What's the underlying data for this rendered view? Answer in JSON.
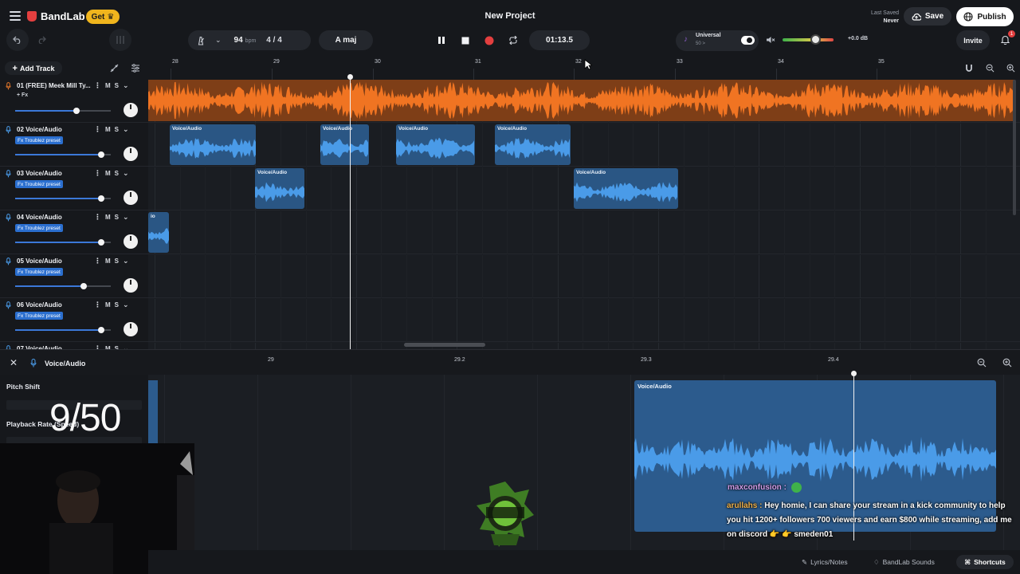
{
  "brand": {
    "name": "BandLab",
    "get_label": "Get"
  },
  "project": {
    "title": "New Project"
  },
  "save_status": {
    "label": "Last Saved",
    "value": "Never"
  },
  "header": {
    "save_label": "Save",
    "publish_label": "Publish",
    "invite_label": "Invite",
    "notification_count": "1"
  },
  "transport": {
    "bpm": "94",
    "bpm_unit": "bpm",
    "time_signature": "4 / 4",
    "key": "A maj",
    "time": "01:13.5"
  },
  "instrument": {
    "name": "Universal",
    "sub": "50 >"
  },
  "master": {
    "db": "+0.0 dB",
    "volume_level": 0.62
  },
  "tracks_panel": {
    "add_track_label": "Add Track"
  },
  "ruler": {
    "ticks": [
      "28",
      "29",
      "30",
      "31",
      "32",
      "33",
      "34",
      "35"
    ]
  },
  "tracks": [
    {
      "name": "01  (FREE) Meek Mill Ty...",
      "fx": "+ Fx",
      "fx_badge": false,
      "volume": 0.64,
      "mute": "M",
      "solo": "S"
    },
    {
      "name": "02  Voice/Audio",
      "fx": "Fx Troublez preset",
      "fx_badge": true,
      "volume": 0.9,
      "mute": "M",
      "solo": "S"
    },
    {
      "name": "03  Voice/Audio",
      "fx": "Fx Troublez preset",
      "fx_badge": true,
      "volume": 0.9,
      "mute": "M",
      "solo": "S"
    },
    {
      "name": "04  Voice/Audio",
      "fx": "Fx Troublez preset",
      "fx_badge": true,
      "volume": 0.9,
      "mute": "M",
      "solo": "S"
    },
    {
      "name": "05  Voice/Audio",
      "fx": "Fx Troublez preset",
      "fx_badge": true,
      "volume": 0.72,
      "mute": "M",
      "solo": "S"
    },
    {
      "name": "06  Voice/Audio",
      "fx": "Fx Troublez preset",
      "fx_badge": true,
      "volume": 0.9,
      "mute": "M",
      "solo": "S"
    },
    {
      "name": "07  Voice/Audio",
      "fx": "",
      "fx_badge": false,
      "volume": 0.9,
      "mute": "M",
      "solo": "S"
    }
  ],
  "clip_label": "Voice/Audio",
  "clip_label_cut": "io",
  "editor": {
    "title": "Voice/Audio",
    "ticks": [
      "29",
      "29.2",
      "29.3",
      "29.4"
    ],
    "pitch_shift_label": "Pitch Shift",
    "playback_rate_label": "Playback Rate (Speed)",
    "clip_title": "Voice/Audio"
  },
  "overlay": {
    "counter": "9/50"
  },
  "chat": {
    "msg1_user": "maxconfusion :",
    "msg2_user": "arullahs :",
    "msg2_text": "Hey homie, I can share your stream in a kick community to help you hit 1200+ followers 700 viewers and earn $800 while streaming, add me on discord 👉 👉 smeden01"
  },
  "footer": {
    "lyrics_label": "Lyrics/Notes",
    "sounds_label": "BandLab Sounds",
    "shortcuts_label": "Shortcuts"
  },
  "colors": {
    "accent_blue": "#2b6fcf",
    "clip_blue": "#2a5684",
    "orange_track": "#7e3e17",
    "record_red": "#e33f3f",
    "get_yellow": "#f0b51d"
  }
}
